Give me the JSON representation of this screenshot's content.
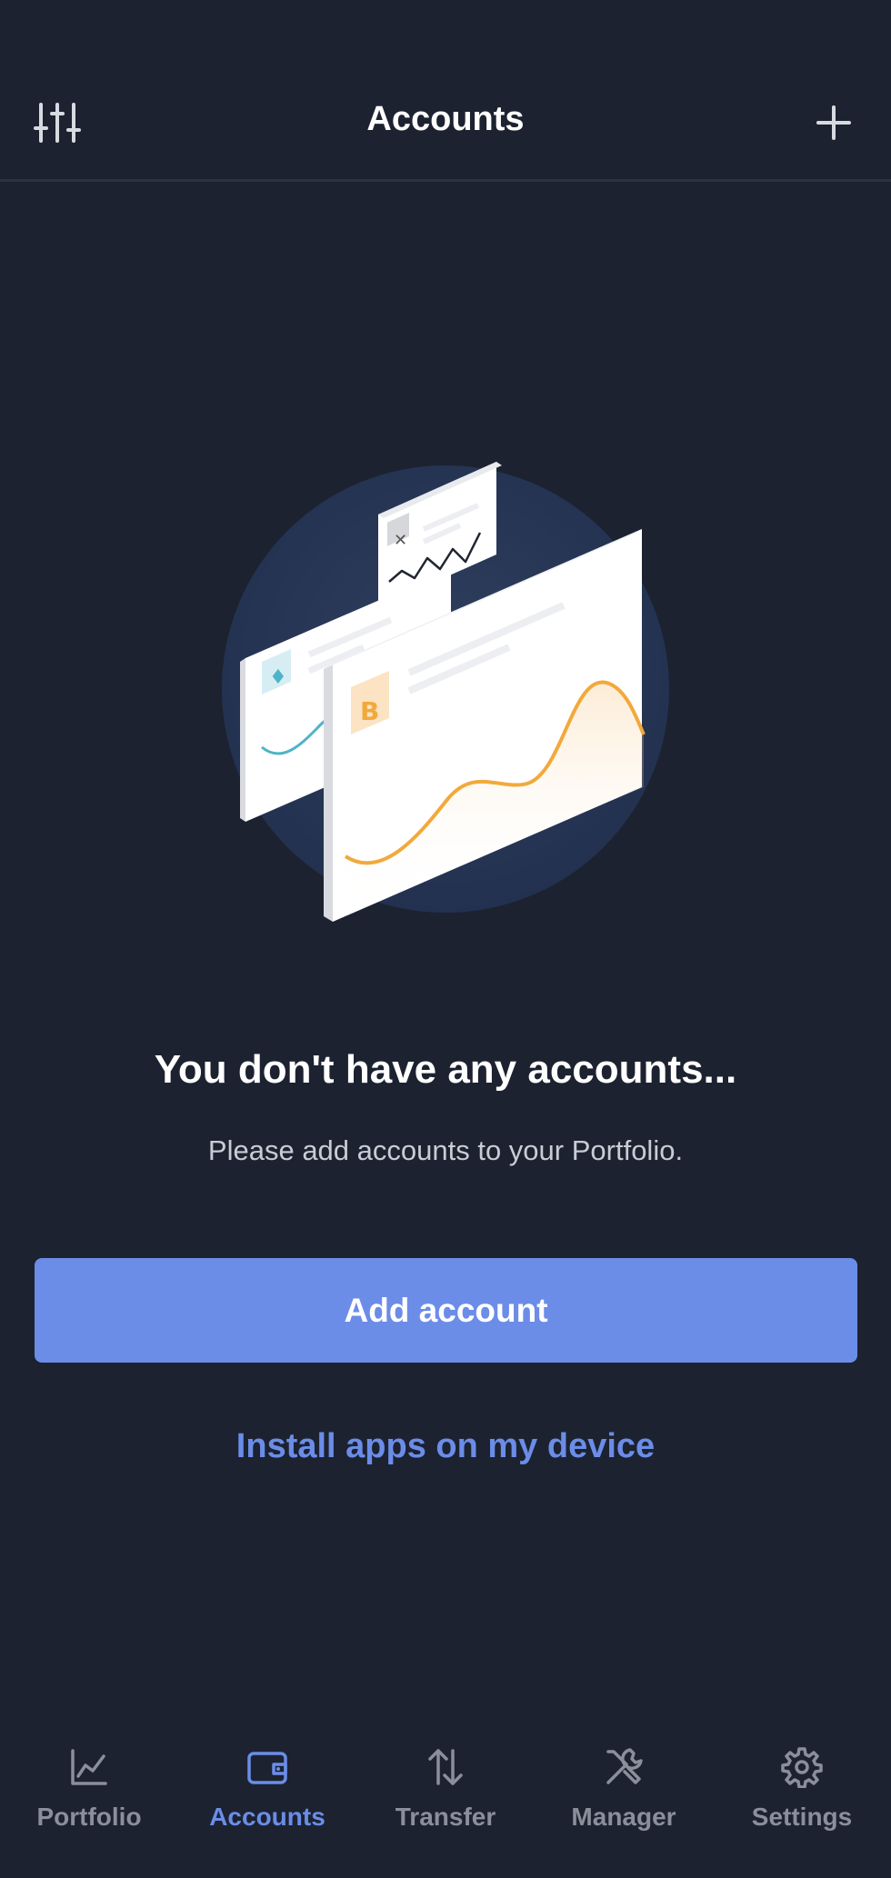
{
  "header": {
    "title": "Accounts",
    "left_icon": "sliders-icon",
    "right_icon": "plus-icon"
  },
  "empty_state": {
    "title": "You don't have any accounts...",
    "subtitle": "Please add accounts to your Portfolio."
  },
  "actions": {
    "primary_label": "Add account",
    "secondary_label": "Install apps on my device"
  },
  "bottom_nav": [
    {
      "label": "Portfolio",
      "icon": "chart-icon",
      "active": false
    },
    {
      "label": "Accounts",
      "icon": "wallet-icon",
      "active": true
    },
    {
      "label": "Transfer",
      "icon": "transfer-icon",
      "active": false
    },
    {
      "label": "Manager",
      "icon": "tools-icon",
      "active": false
    },
    {
      "label": "Settings",
      "icon": "gear-icon",
      "active": false
    }
  ],
  "colors": {
    "background": "#1c2230",
    "accent": "#6b8de8",
    "inactive": "#8a8f9b"
  }
}
